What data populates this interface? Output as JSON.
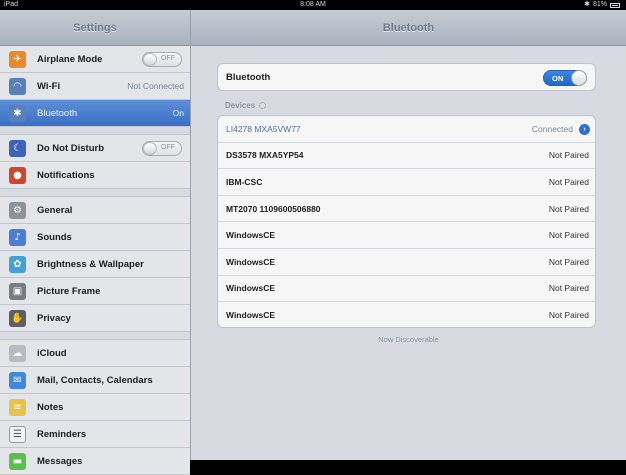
{
  "status_bar": {
    "device": "iPad",
    "time": "8:08 AM",
    "battery": "81%"
  },
  "sidebar": {
    "title": "Settings",
    "items": [
      {
        "label": "Airplane Mode",
        "toggle": "OFF",
        "icon": "airplane-icon",
        "color": "#e8892a"
      },
      {
        "label": "Wi-Fi",
        "value": "Not Connected",
        "icon": "wifi-icon",
        "color": "#5b7fb9"
      },
      {
        "label": "Bluetooth",
        "value": "On",
        "icon": "bluetooth-icon",
        "color": "#5b7fb9",
        "selected": true
      },
      {
        "label": "Do Not Disturb",
        "toggle": "OFF",
        "icon": "moon-icon",
        "color": "#3c63b6"
      },
      {
        "label": "Notifications",
        "icon": "notifications-icon",
        "color": "#d2442c"
      },
      {
        "label": "General",
        "icon": "gear-icon",
        "color": "#8c939c"
      },
      {
        "label": "Sounds",
        "icon": "speaker-icon",
        "color": "#4b7ed3"
      },
      {
        "label": "Brightness & Wallpaper",
        "icon": "flower-icon",
        "color": "#45a0d8"
      },
      {
        "label": "Picture Frame",
        "icon": "frame-icon",
        "color": "#777c84"
      },
      {
        "label": "Privacy",
        "icon": "hand-icon",
        "color": "#5b5f66"
      },
      {
        "label": "iCloud",
        "icon": "cloud-icon",
        "color": "#b7bcc2"
      },
      {
        "label": "Mail, Contacts, Calendars",
        "icon": "mail-icon",
        "color": "#3f8ae0"
      },
      {
        "label": "Notes",
        "icon": "notes-icon",
        "color": "#e6c44a"
      },
      {
        "label": "Reminders",
        "icon": "reminders-icon",
        "color": "#f2f2f2"
      },
      {
        "label": "Messages",
        "icon": "messages-icon",
        "color": "#58c14a"
      }
    ]
  },
  "main": {
    "title": "Bluetooth",
    "bluetooth_label": "Bluetooth",
    "bluetooth_toggle": "ON",
    "devices_label": "Devices",
    "devices": [
      {
        "name": "LI4278 MXA5VW77",
        "status": "Connected"
      },
      {
        "name": "DS3578 MXA5YP54",
        "status": "Not Paired"
      },
      {
        "name": "IBM-CSC",
        "status": "Not Paired"
      },
      {
        "name": "MT2070 1109600506880",
        "status": "Not Paired"
      },
      {
        "name": "WindowsCE",
        "status": "Not Paired"
      },
      {
        "name": "WindowsCE",
        "status": "Not Paired"
      },
      {
        "name": "WindowsCE",
        "status": "Not Paired"
      },
      {
        "name": "WindowsCE",
        "status": "Not Paired"
      }
    ],
    "footer_note": "Now Discoverable"
  }
}
